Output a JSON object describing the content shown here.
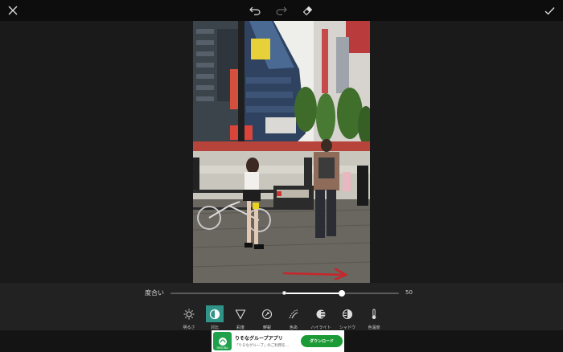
{
  "colors": {
    "accent": "#2f9487",
    "ad_button": "#1c9a35",
    "arrow": "#c7262b"
  },
  "topbar": {
    "close_icon": "close-icon",
    "undo_icon": "undo-icon",
    "redo_icon": "redo-icon",
    "eraser_icon": "eraser-icon",
    "apply_icon": "checkmark-icon"
  },
  "adjust": {
    "label": "度合い",
    "value": "50",
    "slider_value": 0.75,
    "slider_origin": 0.5
  },
  "tools": [
    {
      "label": "明るさ",
      "icon": "brightness-icon",
      "active": false
    },
    {
      "label": "対比",
      "icon": "contrast-icon",
      "active": true
    },
    {
      "label": "彩度",
      "icon": "saturation-icon",
      "active": false
    },
    {
      "label": "鮮鋭",
      "icon": "sharpness-icon",
      "active": false
    },
    {
      "label": "色あ",
      "icon": "fade-icon",
      "active": false
    },
    {
      "label": "ハイライト",
      "icon": "highlight-icon",
      "active": false
    },
    {
      "label": "シャドウ",
      "icon": "shadow-icon",
      "active": false
    },
    {
      "label": "色温度",
      "icon": "temperature-icon",
      "active": false
    }
  ],
  "ad": {
    "title": "りそなグループアプリ",
    "subtitle": "「りそなグループ」のご利用を…",
    "button": "ダウンロード",
    "icon_text": "RESONA"
  }
}
